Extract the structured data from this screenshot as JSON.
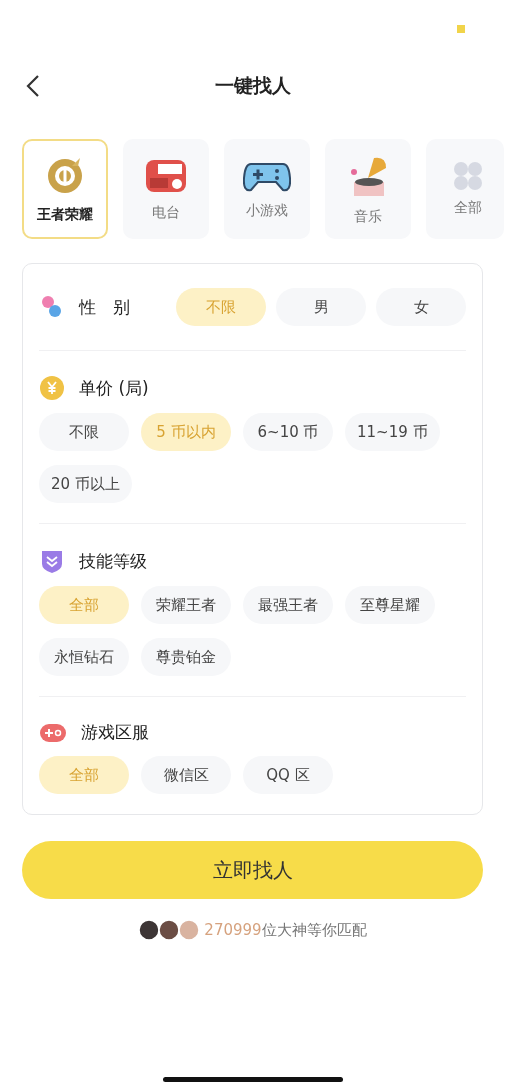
{
  "title": "一键找人",
  "categories": [
    {
      "label": "王者荣耀",
      "selected": true
    },
    {
      "label": "电台",
      "selected": false
    },
    {
      "label": "小游戏",
      "selected": false
    },
    {
      "label": "音乐",
      "selected": false
    },
    {
      "label": "全部",
      "selected": false
    }
  ],
  "sections": [
    {
      "kind": "inline",
      "title": "性　别",
      "options": [
        {
          "label": "不限",
          "selected": true
        },
        {
          "label": "男",
          "selected": false
        },
        {
          "label": "女",
          "selected": false
        }
      ]
    },
    {
      "kind": "wrap",
      "title": "单价 (局)",
      "options": [
        {
          "label": "不限",
          "selected": false
        },
        {
          "label": "5 币以内",
          "selected": true
        },
        {
          "label": "6~10 币",
          "selected": false
        },
        {
          "label": "11~19 币",
          "selected": false
        },
        {
          "label": "20 币以上",
          "selected": false
        }
      ]
    },
    {
      "kind": "wrap",
      "title": "技能等级",
      "options": [
        {
          "label": "全部",
          "selected": true
        },
        {
          "label": "荣耀王者",
          "selected": false
        },
        {
          "label": "最强王者",
          "selected": false
        },
        {
          "label": "至尊星耀",
          "selected": false
        },
        {
          "label": "永恒钻石",
          "selected": false
        },
        {
          "label": "尊贵铂金",
          "selected": false
        }
      ]
    },
    {
      "kind": "wrap",
      "title": "游戏区服",
      "options": [
        {
          "label": "全部",
          "selected": true
        },
        {
          "label": "微信区",
          "selected": false
        },
        {
          "label": "QQ 区",
          "selected": false
        }
      ]
    }
  ],
  "action": "立即找人",
  "footer": {
    "count": "270999",
    "text": "位大神等你匹配"
  }
}
